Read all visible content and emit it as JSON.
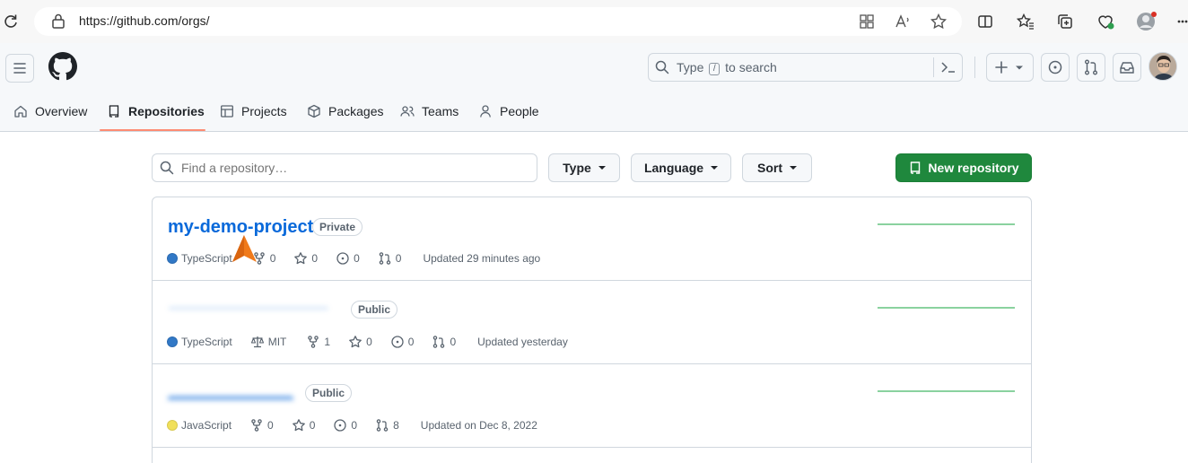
{
  "browser": {
    "url": "https://github.com/orgs/"
  },
  "header": {
    "search_prefix": "Type",
    "search_key": "/",
    "search_suffix": "to search"
  },
  "tabs": [
    {
      "label": "Overview"
    },
    {
      "label": "Repositories",
      "active": true
    },
    {
      "label": "Projects"
    },
    {
      "label": "Packages"
    },
    {
      "label": "Teams"
    },
    {
      "label": "People"
    }
  ],
  "filters": {
    "find_placeholder": "Find a repository…",
    "type_label": "Type",
    "language_label": "Language",
    "sort_label": "Sort",
    "new_repo_label": "New repository"
  },
  "repos": [
    {
      "name": "my-demo-project",
      "visibility": "Private",
      "language": "TypeScript",
      "language_color": "#3178c6",
      "forks": "0",
      "stars": "0",
      "issues": "0",
      "pulls": "0",
      "updated": "Updated 29 minutes ago"
    },
    {
      "name": "",
      "visibility": "Public",
      "language": "TypeScript",
      "language_color": "#3178c6",
      "license": "MIT",
      "forks": "1",
      "stars": "0",
      "issues": "0",
      "pulls": "0",
      "updated": "Updated yesterday"
    },
    {
      "name": "",
      "visibility": "Public",
      "language": "JavaScript",
      "language_color": "#f1e05a",
      "forks": "0",
      "stars": "0",
      "issues": "0",
      "pulls": "8",
      "updated": "Updated on Dec 8, 2022"
    }
  ],
  "colors": {
    "accent_link": "#0969da",
    "primary_button": "#1f883d",
    "active_tab_underline": "#fd8c73"
  }
}
